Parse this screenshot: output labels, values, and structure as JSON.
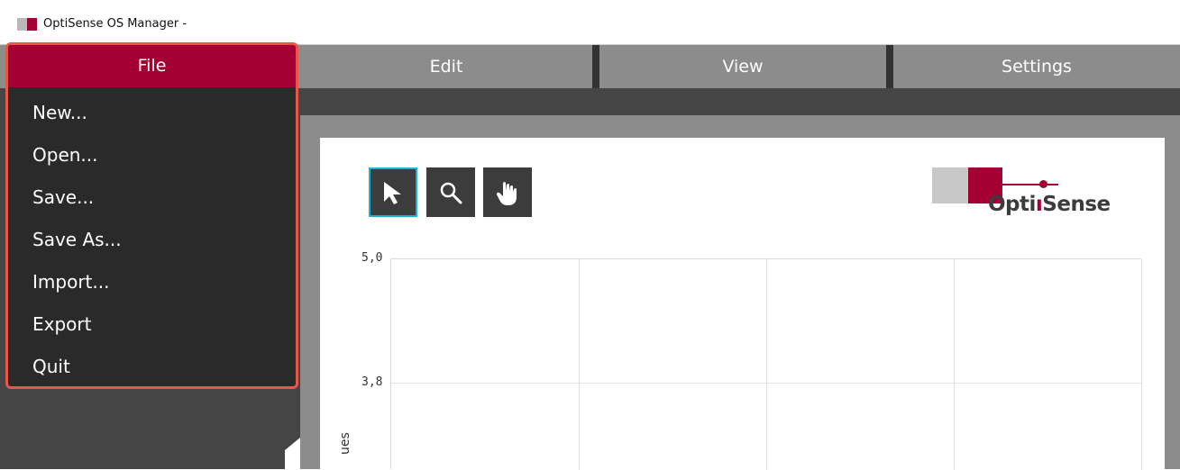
{
  "window": {
    "title": "OptiSense OS Manager -"
  },
  "menubar": {
    "tabs": [
      {
        "label": "File"
      },
      {
        "label": "Edit"
      },
      {
        "label": "View"
      },
      {
        "label": "Settings"
      }
    ]
  },
  "file_menu": {
    "items": [
      {
        "label": "New..."
      },
      {
        "label": "Open..."
      },
      {
        "label": "Save..."
      },
      {
        "label": "Save As..."
      },
      {
        "label": "Import..."
      },
      {
        "label": "Export"
      },
      {
        "label": "Quit"
      }
    ]
  },
  "toolbar": {
    "tools": [
      {
        "icon": "cursor-icon",
        "selected": true
      },
      {
        "icon": "zoom-icon",
        "selected": false
      },
      {
        "icon": "pan-hand-icon",
        "selected": false
      }
    ]
  },
  "brand": {
    "opti": "Opti",
    "i_accent": "",
    "sense": "Sense"
  },
  "colors": {
    "accent": "#a50034",
    "focus": "#e8574a",
    "selected_tool_border": "#19b3d1"
  },
  "chart_data": {
    "type": "line",
    "ylabel_visible": "ues",
    "y_ticks": [
      "5,0",
      "3,8"
    ],
    "grid": true
  }
}
